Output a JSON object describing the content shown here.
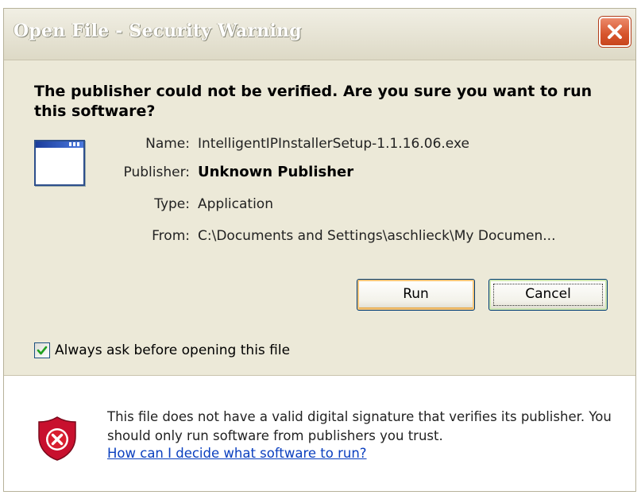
{
  "window": {
    "title": "Open File - Security Warning"
  },
  "heading": "The publisher could not be verified.  Are you sure you want to run this software?",
  "details": {
    "name_label": "Name:",
    "name_value": "IntelligentIPInstallerSetup-1.1.16.06.exe",
    "publisher_label": "Publisher:",
    "publisher_value": "Unknown Publisher",
    "type_label": "Type:",
    "type_value": "Application",
    "from_label": "From:",
    "from_value": "C:\\Documents and Settings\\aschlieck\\My Documen..."
  },
  "buttons": {
    "run_label": "Run",
    "cancel_label": "Cancel"
  },
  "checkbox": {
    "label": "Always ask before opening this file",
    "checked": true
  },
  "info": {
    "message": "This file does not have a valid digital signature that verifies its publisher.  You should only run software from publishers you trust.",
    "link_text": "How can I decide what software to run?"
  },
  "icons": {
    "close": "close-icon",
    "file": "application-window-icon",
    "shield": "shield-error-icon",
    "check": "checkmark-icon"
  },
  "colors": {
    "title_bar": "#ddd9c6",
    "close_button": "#d6542c",
    "link": "#0a3fbf",
    "shield": "#c8102e"
  }
}
